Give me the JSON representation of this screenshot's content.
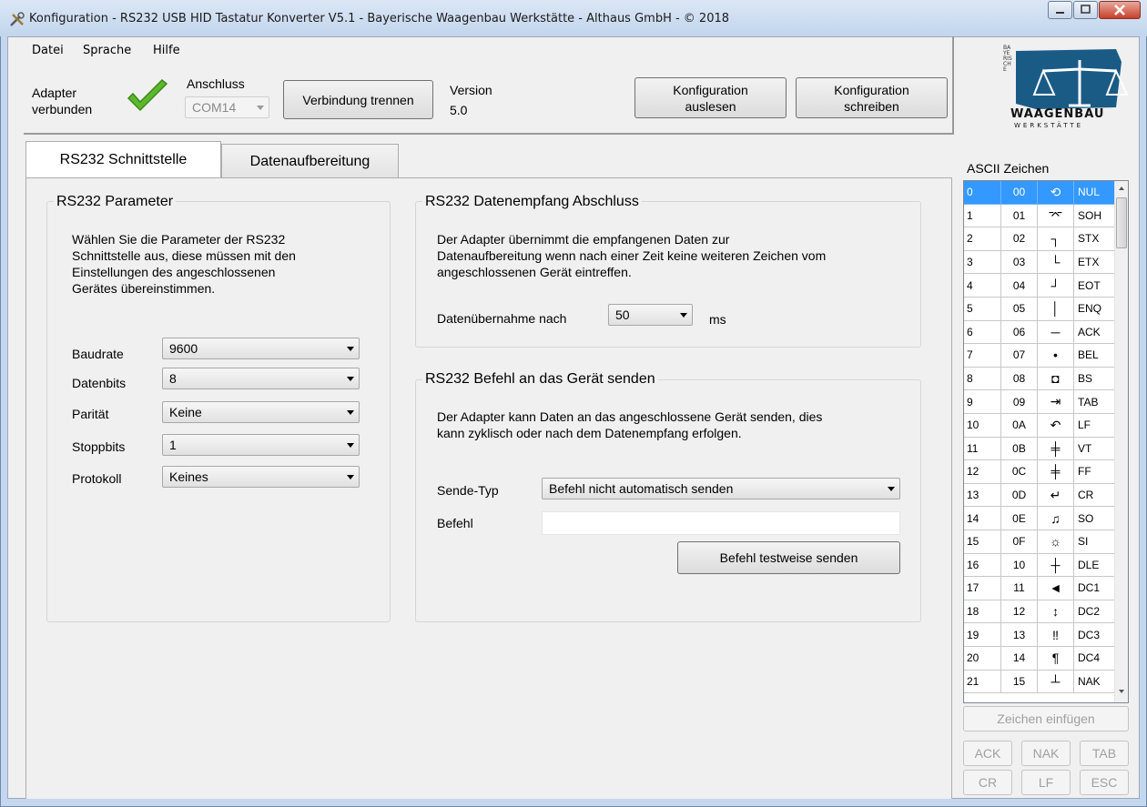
{
  "window": {
    "title": "Konfiguration - RS232 USB HID Tastatur Konverter V5.1 - Bayerische Waagenbau Werkstätte - Althaus GmbH - © 2018"
  },
  "menu": {
    "items": [
      "Datei",
      "Sprache",
      "Hilfe"
    ]
  },
  "toolbar": {
    "adapter_status": "Adapter\nverbunden",
    "port_label": "Anschluss",
    "port_value": "COM14",
    "disconnect_label": "Verbindung trennen",
    "version_label": "Version",
    "version_value": "5.0",
    "read_config_label": "Konfiguration\nauslesen",
    "write_config_label": "Konfiguration\nschreiben"
  },
  "logo": {
    "side_text": "BAYERISCHE",
    "brand": "WAAGENBAU",
    "sub": "WERKSTÄTTE"
  },
  "tabs": [
    {
      "label": "RS232 Schnittstelle",
      "active": true
    },
    {
      "label": "Datenaufbereitung",
      "active": false
    }
  ],
  "params": {
    "title": "RS232 Parameter",
    "description": "Wählen Sie die Parameter der RS232\nSchnittstelle aus, diese müssen mit den\nEinstellungen des angeschlossenen\nGerätes übereinstimmen.",
    "fields": [
      {
        "label": "Baudrate",
        "value": "9600"
      },
      {
        "label": "Datenbits",
        "value": "8"
      },
      {
        "label": "Parität",
        "value": "Keine"
      },
      {
        "label": "Stoppbits",
        "value": "1"
      },
      {
        "label": "Protokoll",
        "value": "Keines"
      }
    ]
  },
  "receive": {
    "title": "RS232 Datenempfang Abschluss",
    "description": "Der Adapter übernimmt die empfangenen Daten zur\nDatenaufbereitung wenn nach einer Zeit keine weiteren Zeichen vom\nangeschlossenen Gerät eintreffen.",
    "timeout_label": "Datenübernahme nach",
    "timeout_value": "50",
    "unit": "ms"
  },
  "command": {
    "title": "RS232 Befehl an das Gerät senden",
    "description": "Der Adapter kann Daten an das angeschlossene Gerät senden, dies\nkann zyklisch oder nach dem Datenempfang erfolgen.",
    "send_type_label": "Sende-Typ",
    "send_type_value": "Befehl nicht automatisch senden",
    "command_label": "Befehl",
    "command_value": "",
    "test_button": "Befehl testweise senden"
  },
  "ascii": {
    "title": "ASCII Zeichen",
    "selected_index": 0,
    "rows": [
      [
        "0",
        "00",
        "⟲",
        "NUL"
      ],
      [
        "1",
        "01",
        "⌤",
        "SOH"
      ],
      [
        "2",
        "02",
        "┐",
        "STX"
      ],
      [
        "3",
        "03",
        "└",
        "ETX"
      ],
      [
        "4",
        "04",
        "┘",
        "EOT"
      ],
      [
        "5",
        "05",
        "│",
        "ENQ"
      ],
      [
        "6",
        "06",
        "─",
        "ACK"
      ],
      [
        "7",
        "07",
        "•",
        "BEL"
      ],
      [
        "8",
        "08",
        "◘",
        "BS"
      ],
      [
        "9",
        "09",
        "⇥",
        "TAB"
      ],
      [
        "10",
        "0A",
        "↶",
        "LF"
      ],
      [
        "11",
        "0B",
        "╪",
        "VT"
      ],
      [
        "12",
        "0C",
        "╪",
        "FF"
      ],
      [
        "13",
        "0D",
        "↵",
        "CR"
      ],
      [
        "14",
        "0E",
        "♫",
        "SO"
      ],
      [
        "15",
        "0F",
        "☼",
        "SI"
      ],
      [
        "16",
        "10",
        "┼",
        "DLE"
      ],
      [
        "17",
        "11",
        "◄",
        "DC1"
      ],
      [
        "18",
        "12",
        "↕",
        "DC2"
      ],
      [
        "19",
        "13",
        "‼",
        "DC3"
      ],
      [
        "20",
        "14",
        "¶",
        "DC4"
      ],
      [
        "21",
        "15",
        "┴",
        "NAK"
      ]
    ],
    "insert_button": "Zeichen einfügen",
    "quick_buttons": [
      "ACK",
      "NAK",
      "TAB",
      "CR",
      "LF",
      "ESC"
    ]
  }
}
